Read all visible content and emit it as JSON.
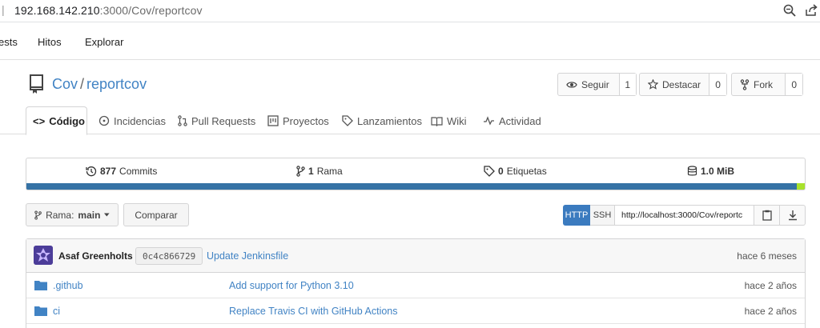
{
  "browser": {
    "url_host": "192.168.142.210",
    "url_rest": ":3000/Cov/reportcov"
  },
  "topnav": {
    "items": [
      "ests",
      "Hitos",
      "Explorar"
    ]
  },
  "repo": {
    "owner": "Cov",
    "separator": "/",
    "name": "reportcov",
    "watch_label": "Seguir",
    "watch_count": "1",
    "star_label": "Destacar",
    "star_count": "0",
    "fork_label": "Fork",
    "fork_count": "0"
  },
  "tabs": [
    {
      "label": "Código",
      "icon": "code-icon",
      "active": true
    },
    {
      "label": "Incidencias",
      "icon": "issue-icon"
    },
    {
      "label": "Pull Requests",
      "icon": "pull-request-icon"
    },
    {
      "label": "Proyectos",
      "icon": "project-icon"
    },
    {
      "label": "Lanzamientos",
      "icon": "tag-icon"
    },
    {
      "label": "Wiki",
      "icon": "book-icon"
    },
    {
      "label": "Actividad",
      "icon": "pulse-icon"
    }
  ],
  "stats": {
    "commits_count": "877",
    "commits_label": "Commits",
    "branches_count": "1",
    "branches_label": "Rama",
    "tags_count": "0",
    "tags_label": "Etiquetas",
    "size": "1.0 MiB"
  },
  "language_bar": {
    "primary_color": "#3572a5",
    "secondary_color": "#a8e22b"
  },
  "branch": {
    "prefix": "Rama:",
    "name": "main",
    "compare_label": "Comparar"
  },
  "clone": {
    "http_label": "HTTP",
    "ssh_label": "SSH",
    "url": "http://localhost:3000/Cov/reportc"
  },
  "latest_commit": {
    "author": "Asaf Greenholts",
    "sha": "0c4c866729",
    "message": "Update Jenkinsfile",
    "time": "hace 6 meses"
  },
  "files": [
    {
      "name": ".github",
      "message": "Add support for Python 3.10",
      "time": "hace 2 años"
    },
    {
      "name": "ci",
      "message": "Replace Travis CI with GitHub Actions",
      "time": "hace 2 años"
    }
  ]
}
